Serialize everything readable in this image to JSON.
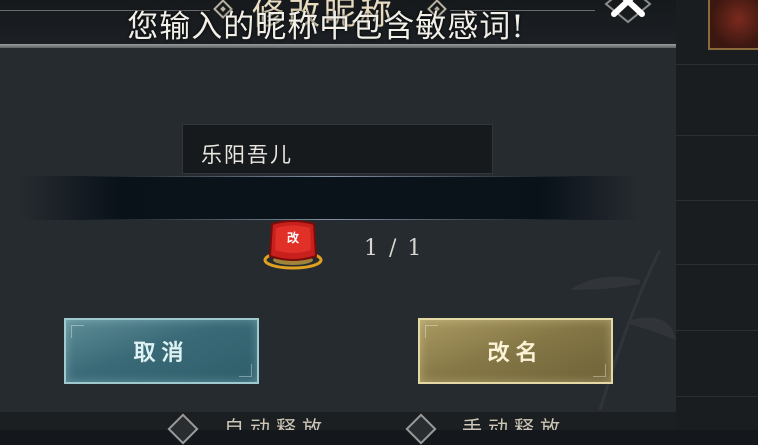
{
  "dialog": {
    "title": "修改昵称",
    "close_icon": "close-icon",
    "input": {
      "value": "乐阳吾儿"
    },
    "toast": "您输入的昵称中包含敏感词!",
    "item": {
      "icon": "rename-card-icon",
      "count": "1 / 1"
    },
    "buttons": {
      "cancel": "取消",
      "rename": "改名"
    }
  },
  "background": {
    "bottom_left": "自动释放",
    "bottom_right": "手动释放"
  },
  "colors": {
    "cancel_button": "#3a6a77",
    "rename_button": "#847645",
    "toast_text": "#f2efe8"
  }
}
